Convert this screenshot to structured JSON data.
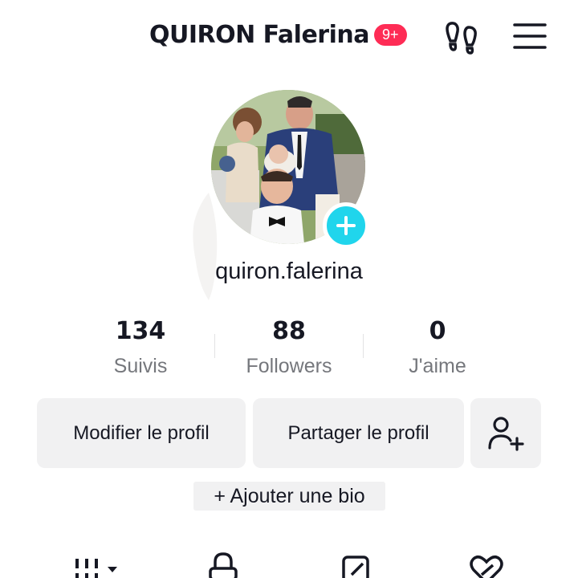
{
  "header": {
    "title": "QUIRON Falerina",
    "badge": "9+"
  },
  "icons": {
    "footprint": "footprints-icon",
    "menu": "hamburger-menu-icon",
    "add": "plus-icon",
    "add_friend": "add-user-icon"
  },
  "profile": {
    "handle": "quiron.falerina"
  },
  "stats": [
    {
      "value": "134",
      "label": "Suivis"
    },
    {
      "value": "88",
      "label": "Followers"
    },
    {
      "value": "0",
      "label": "J'aime"
    }
  ],
  "actions": {
    "edit_label": "Modifier le profil",
    "share_label": "Partager le profil"
  },
  "bio": {
    "add_label": "+ Ajouter une bio"
  },
  "tabs": [
    {
      "icon": "videos-grid-icon"
    },
    {
      "icon": "lock-icon"
    },
    {
      "icon": "reposts-icon"
    },
    {
      "icon": "liked-heart-icon"
    }
  ],
  "colors": {
    "badge": "#fe2c55",
    "add_button": "#20d5ec",
    "button_bg": "#f1f1f2",
    "secondary_text": "#75777c"
  }
}
